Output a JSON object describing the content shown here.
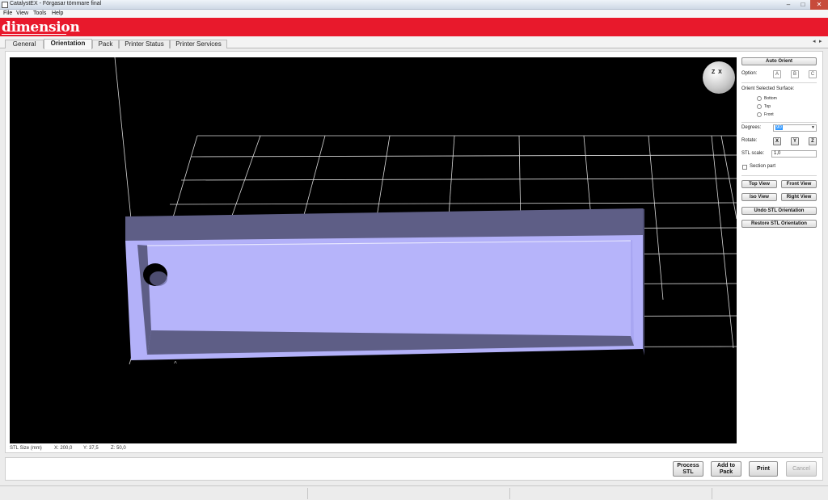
{
  "window": {
    "title": "CatalystEX - Förgasar tömmare final",
    "min": "–",
    "max": "□",
    "close": "✕"
  },
  "menu": [
    "File",
    "View",
    "Tools",
    "Help"
  ],
  "brand": "dimension",
  "tabs": [
    "General",
    "Orientation",
    "Pack",
    "Printer Status",
    "Printer Services"
  ],
  "active_tab": "Orientation",
  "tab_scroll": {
    "left": "◂",
    "right": "▸"
  },
  "viewport": {
    "axis_glyph": "Z  X",
    "size_label": "STL Size (mm)",
    "x": "X: 200,0",
    "y": "Y: 37,5",
    "z": "Z: 50,0"
  },
  "panel": {
    "auto_orient": "Auto Orient",
    "option_label": "Option:",
    "options": [
      "A",
      "B",
      "C"
    ],
    "orient_surface_label": "Orient Selected Surface:",
    "surfaces": [
      "Bottom",
      "Top",
      "Front"
    ],
    "degrees_label": "Degrees:",
    "degrees_value": "90",
    "rotate_label": "Rotate:",
    "axes": [
      "X",
      "Y",
      "Z"
    ],
    "stl_scale_label": "STL scale:",
    "stl_scale_value": "1,0",
    "section_part": "Section part",
    "top_view": "Top View",
    "front_view": "Front View",
    "iso_view": "Iso View",
    "right_view": "Right View",
    "undo": "Undo STL Orientation",
    "restore": "Restore STL Orientation"
  },
  "footer": {
    "process": "Process\nSTL",
    "add": "Add to\nPack",
    "print": "Print",
    "cancel": "Cancel"
  },
  "colors": {
    "brand_red": "#e8192c",
    "part_face": "#b3b1f9",
    "part_side": "#5e5e86",
    "viewport_bg": "#000000"
  }
}
